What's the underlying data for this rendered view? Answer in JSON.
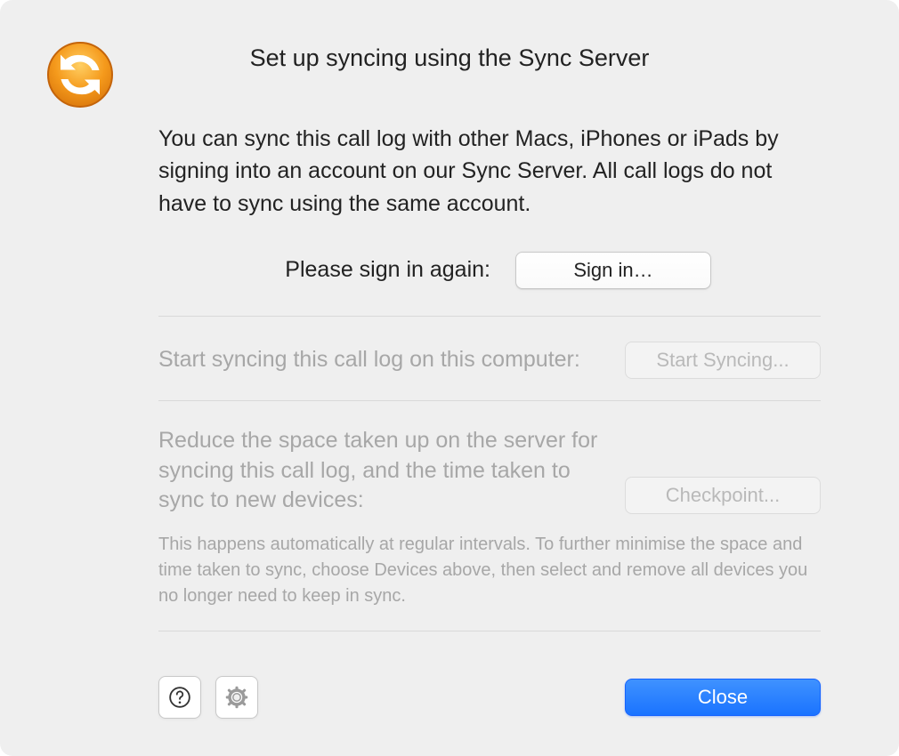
{
  "title": "Set up syncing using the Sync Server",
  "intro": "You can sync this call log with other Macs, iPhones or iPads by signing into an account on our Sync Server. All call logs do not have to sync using the same account.",
  "signin": {
    "label": "Please sign in again:",
    "button": "Sign in…"
  },
  "start": {
    "label": "Start syncing this call log on this computer:",
    "button": "Start Syncing..."
  },
  "checkpoint": {
    "label": "Reduce the space taken up on the server for syncing this call log, and the time taken to sync to new devices:",
    "button": "Checkpoint...",
    "hint": "This happens automatically at regular intervals. To further minimise the space and time taken to sync, choose Devices above, then select and remove all devices you no longer need to keep in sync."
  },
  "footer": {
    "close": "Close"
  }
}
